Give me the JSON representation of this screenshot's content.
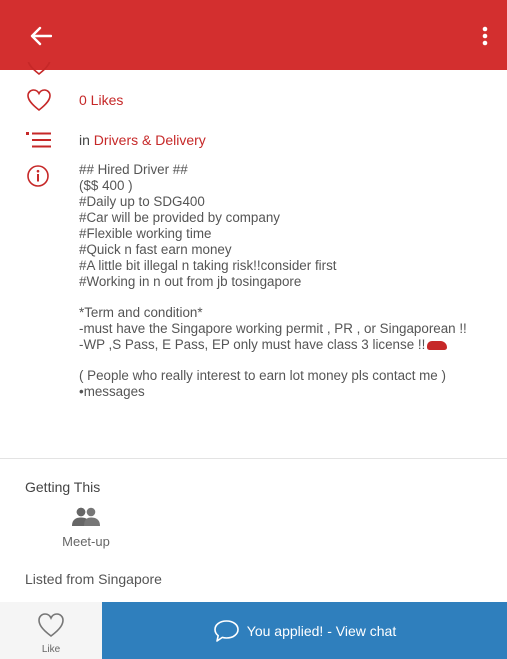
{
  "colors": {
    "appbar": "#d32f2f",
    "accent_red": "#c62828",
    "apply_button": "#2f7fbd"
  },
  "appbar": {
    "back_icon": "arrow-left-icon",
    "menu_icon": "more-vertical-icon"
  },
  "likes": {
    "icon": "heart-outline-icon",
    "text": "0 Likes"
  },
  "category": {
    "icon": "list-icon",
    "prefix": "in",
    "name": "Drivers & Delivery"
  },
  "description": {
    "icon": "info-icon",
    "lines_1": [
      "## Hired Driver ##",
      "($$ 400 )",
      "#Daily up to SDG400",
      "#Car will be provided by company",
      "#Flexible working time",
      "#Quick n fast earn money",
      "#A little bit illegal n taking risk!!consider first",
      "#Working in n out from jb tosingapore"
    ],
    "lines_2": [
      "*Term and condition*",
      "-must have the Singapore working permit , PR , or Singaporean !!",
      "-WP ,S Pass, E Pass, EP only must have class 3 license !!"
    ],
    "lines_3": [
      "( People who really interest to earn lot money pls contact me )",
      "•messages"
    ]
  },
  "getting": {
    "title": "Getting This",
    "method_icon": "people-icon",
    "method_label": "Meet-up"
  },
  "listed_from": "Listed from Singapore",
  "bottom": {
    "like_icon": "heart-outline-icon",
    "like_label": "Like",
    "chat_icon": "chat-bubble-icon",
    "apply_label": "You applied! - View chat"
  }
}
